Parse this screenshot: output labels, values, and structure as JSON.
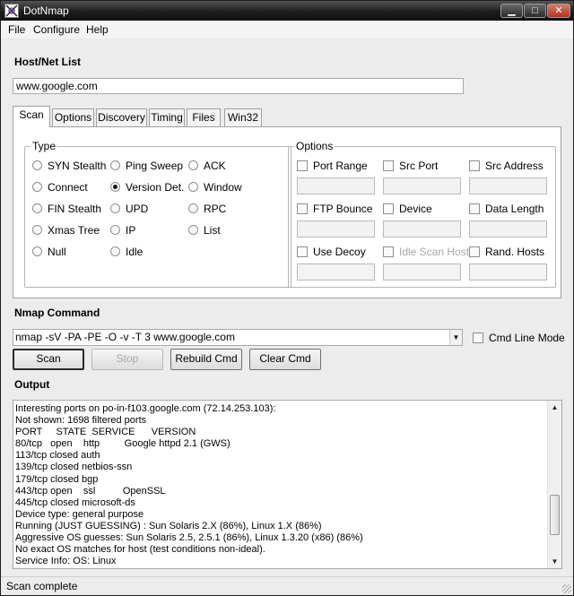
{
  "window": {
    "title": "DotNmap",
    "title_icon": "nmap-eye-icon"
  },
  "menu": [
    "File",
    "Configure",
    "Help"
  ],
  "host": {
    "label": "Host/Net List",
    "value": "www.google.com"
  },
  "tabs": [
    "Scan",
    "Options",
    "Discovery",
    "Timing",
    "Files",
    "Win32"
  ],
  "active_tab": "Scan",
  "type_group": {
    "label": "Type",
    "items": [
      {
        "label": "SYN Stealth",
        "selected": false
      },
      {
        "label": "Ping Sweep",
        "selected": false
      },
      {
        "label": "ACK",
        "selected": false
      },
      {
        "label": "Connect",
        "selected": false
      },
      {
        "label": "Version Det.",
        "selected": true
      },
      {
        "label": "Window",
        "selected": false
      },
      {
        "label": "FIN Stealth",
        "selected": false
      },
      {
        "label": "UPD",
        "selected": false
      },
      {
        "label": "RPC",
        "selected": false
      },
      {
        "label": "Xmas Tree",
        "selected": false
      },
      {
        "label": "IP",
        "selected": false
      },
      {
        "label": "List",
        "selected": false
      },
      {
        "label": "Null",
        "selected": false
      },
      {
        "label": "Idle",
        "selected": false
      }
    ]
  },
  "options_group": {
    "label": "Options",
    "items": [
      {
        "label": "Port Range",
        "checked": false,
        "enabled": true
      },
      {
        "label": "Src Port",
        "checked": false,
        "enabled": true
      },
      {
        "label": "Src Address",
        "checked": false,
        "enabled": true
      },
      {
        "label": "FTP Bounce",
        "checked": false,
        "enabled": true
      },
      {
        "label": "Device",
        "checked": false,
        "enabled": true
      },
      {
        "label": "Data Length",
        "checked": false,
        "enabled": true
      },
      {
        "label": "Use Decoy",
        "checked": false,
        "enabled": true
      },
      {
        "label": "Idle Scan Host",
        "checked": false,
        "enabled": false
      },
      {
        "label": "Rand. Hosts",
        "checked": false,
        "enabled": true
      }
    ]
  },
  "command": {
    "label": "Nmap Command",
    "value": "nmap -sV -PA -PE -O -v -T 3 www.google.com",
    "cmd_line_mode_label": "Cmd Line Mode",
    "cmd_line_mode_checked": false
  },
  "buttons": {
    "scan": "Scan",
    "stop": "Stop",
    "rebuild": "Rebuild Cmd",
    "clear": "Clear Cmd"
  },
  "output": {
    "label": "Output",
    "lines": [
      "Interesting ports on po-in-f103.google.com (72.14.253.103):",
      "Not shown: 1698 filtered ports",
      "PORT     STATE  SERVICE      VERSION",
      "80/tcp   open    http         Google httpd 2.1 (GWS)",
      "113/tcp closed auth",
      "139/tcp closed netbios-ssn",
      "179/tcp closed bgp",
      "443/tcp open    ssl          OpenSSL",
      "445/tcp closed microsoft-ds",
      "Device type: general purpose",
      "Running (JUST GUESSING) : Sun Solaris 2.X (86%), Linux 1.X (86%)",
      "Aggressive OS guesses: Sun Solaris 2.5, 2.5.1 (86%), Linux 1.3.20 (x86) (86%)",
      "No exact OS matches for host (test conditions non-ideal).",
      "Service Info: OS: Linux"
    ]
  },
  "status": "Scan complete"
}
